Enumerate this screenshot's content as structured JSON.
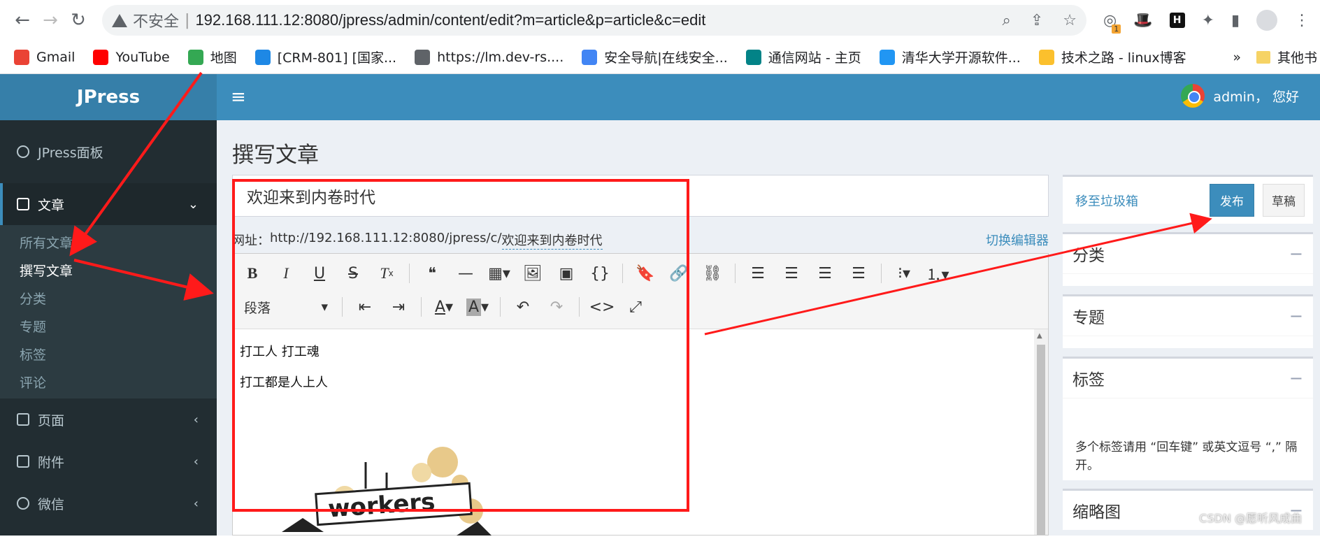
{
  "browser": {
    "security_label": "不安全",
    "url": "192.168.111.12:8080/jpress/admin/content/edit?m=article&p=article&c=edit",
    "ext_badge": "1",
    "bookmarks": [
      {
        "label": "Gmail",
        "icon": "gmail-icon",
        "color": "#ea4335"
      },
      {
        "label": "YouTube",
        "icon": "youtube-icon",
        "color": "#ff0000"
      },
      {
        "label": "地图",
        "icon": "maps-icon",
        "color": "#34a853"
      },
      {
        "label": "[CRM-801] [国家...",
        "icon": "crm-icon",
        "color": "#1e88e5"
      },
      {
        "label": "https://lm.dev-rs....",
        "icon": "globe-icon",
        "color": "#5f6368"
      },
      {
        "label": "安全导航|在线安全...",
        "icon": "google-icon",
        "color": "#4285f4"
      },
      {
        "label": "通信网站 - 主页",
        "icon": "sharepoint-icon",
        "color": "#038387"
      },
      {
        "label": "清华大学开源软件...",
        "icon": "tsinghua-icon",
        "color": "#2196f3"
      },
      {
        "label": "技术之路 - linux博客",
        "icon": "blog-icon",
        "color": "#fbc02d"
      }
    ],
    "more_label": "»",
    "other_bookmarks": "其他书"
  },
  "app": {
    "logo": "JPress",
    "user": "admin， 您好",
    "colors": {
      "brand": "#3c8dbc",
      "sidebar": "#222d32",
      "annotation": "#ff1a1a"
    }
  },
  "sidebar": {
    "dashboard": "JPress面板",
    "article": "文章",
    "article_sub": [
      "所有文章",
      "撰写文章",
      "分类",
      "专题",
      "标签",
      "评论"
    ],
    "page": "页面",
    "attachment": "附件",
    "wechat": "微信"
  },
  "main": {
    "page_title": "撰写文章",
    "article_title": "欢迎来到内卷时代",
    "url_label": "网址：",
    "url_prefix": "http://192.168.111.12:8080/jpress/c/",
    "url_slug": "欢迎来到内卷时代",
    "switch_editor": "切换编辑器",
    "paragraph_select": "段落",
    "body_lines": [
      "打工人 打工魂",
      "打工都是人上人"
    ],
    "image_text": "workers"
  },
  "right": {
    "trash": "移至垃圾箱",
    "publish": "发布",
    "draft": "草稿",
    "category": "分类",
    "topic": "专题",
    "tags": "标签",
    "tag_hint": "多个标签请用 “回车键” 或英文逗号 “,” 隔开。",
    "thumbnail": "缩略图",
    "collapse": "−"
  },
  "watermark": "CSDN @愿听风成曲"
}
